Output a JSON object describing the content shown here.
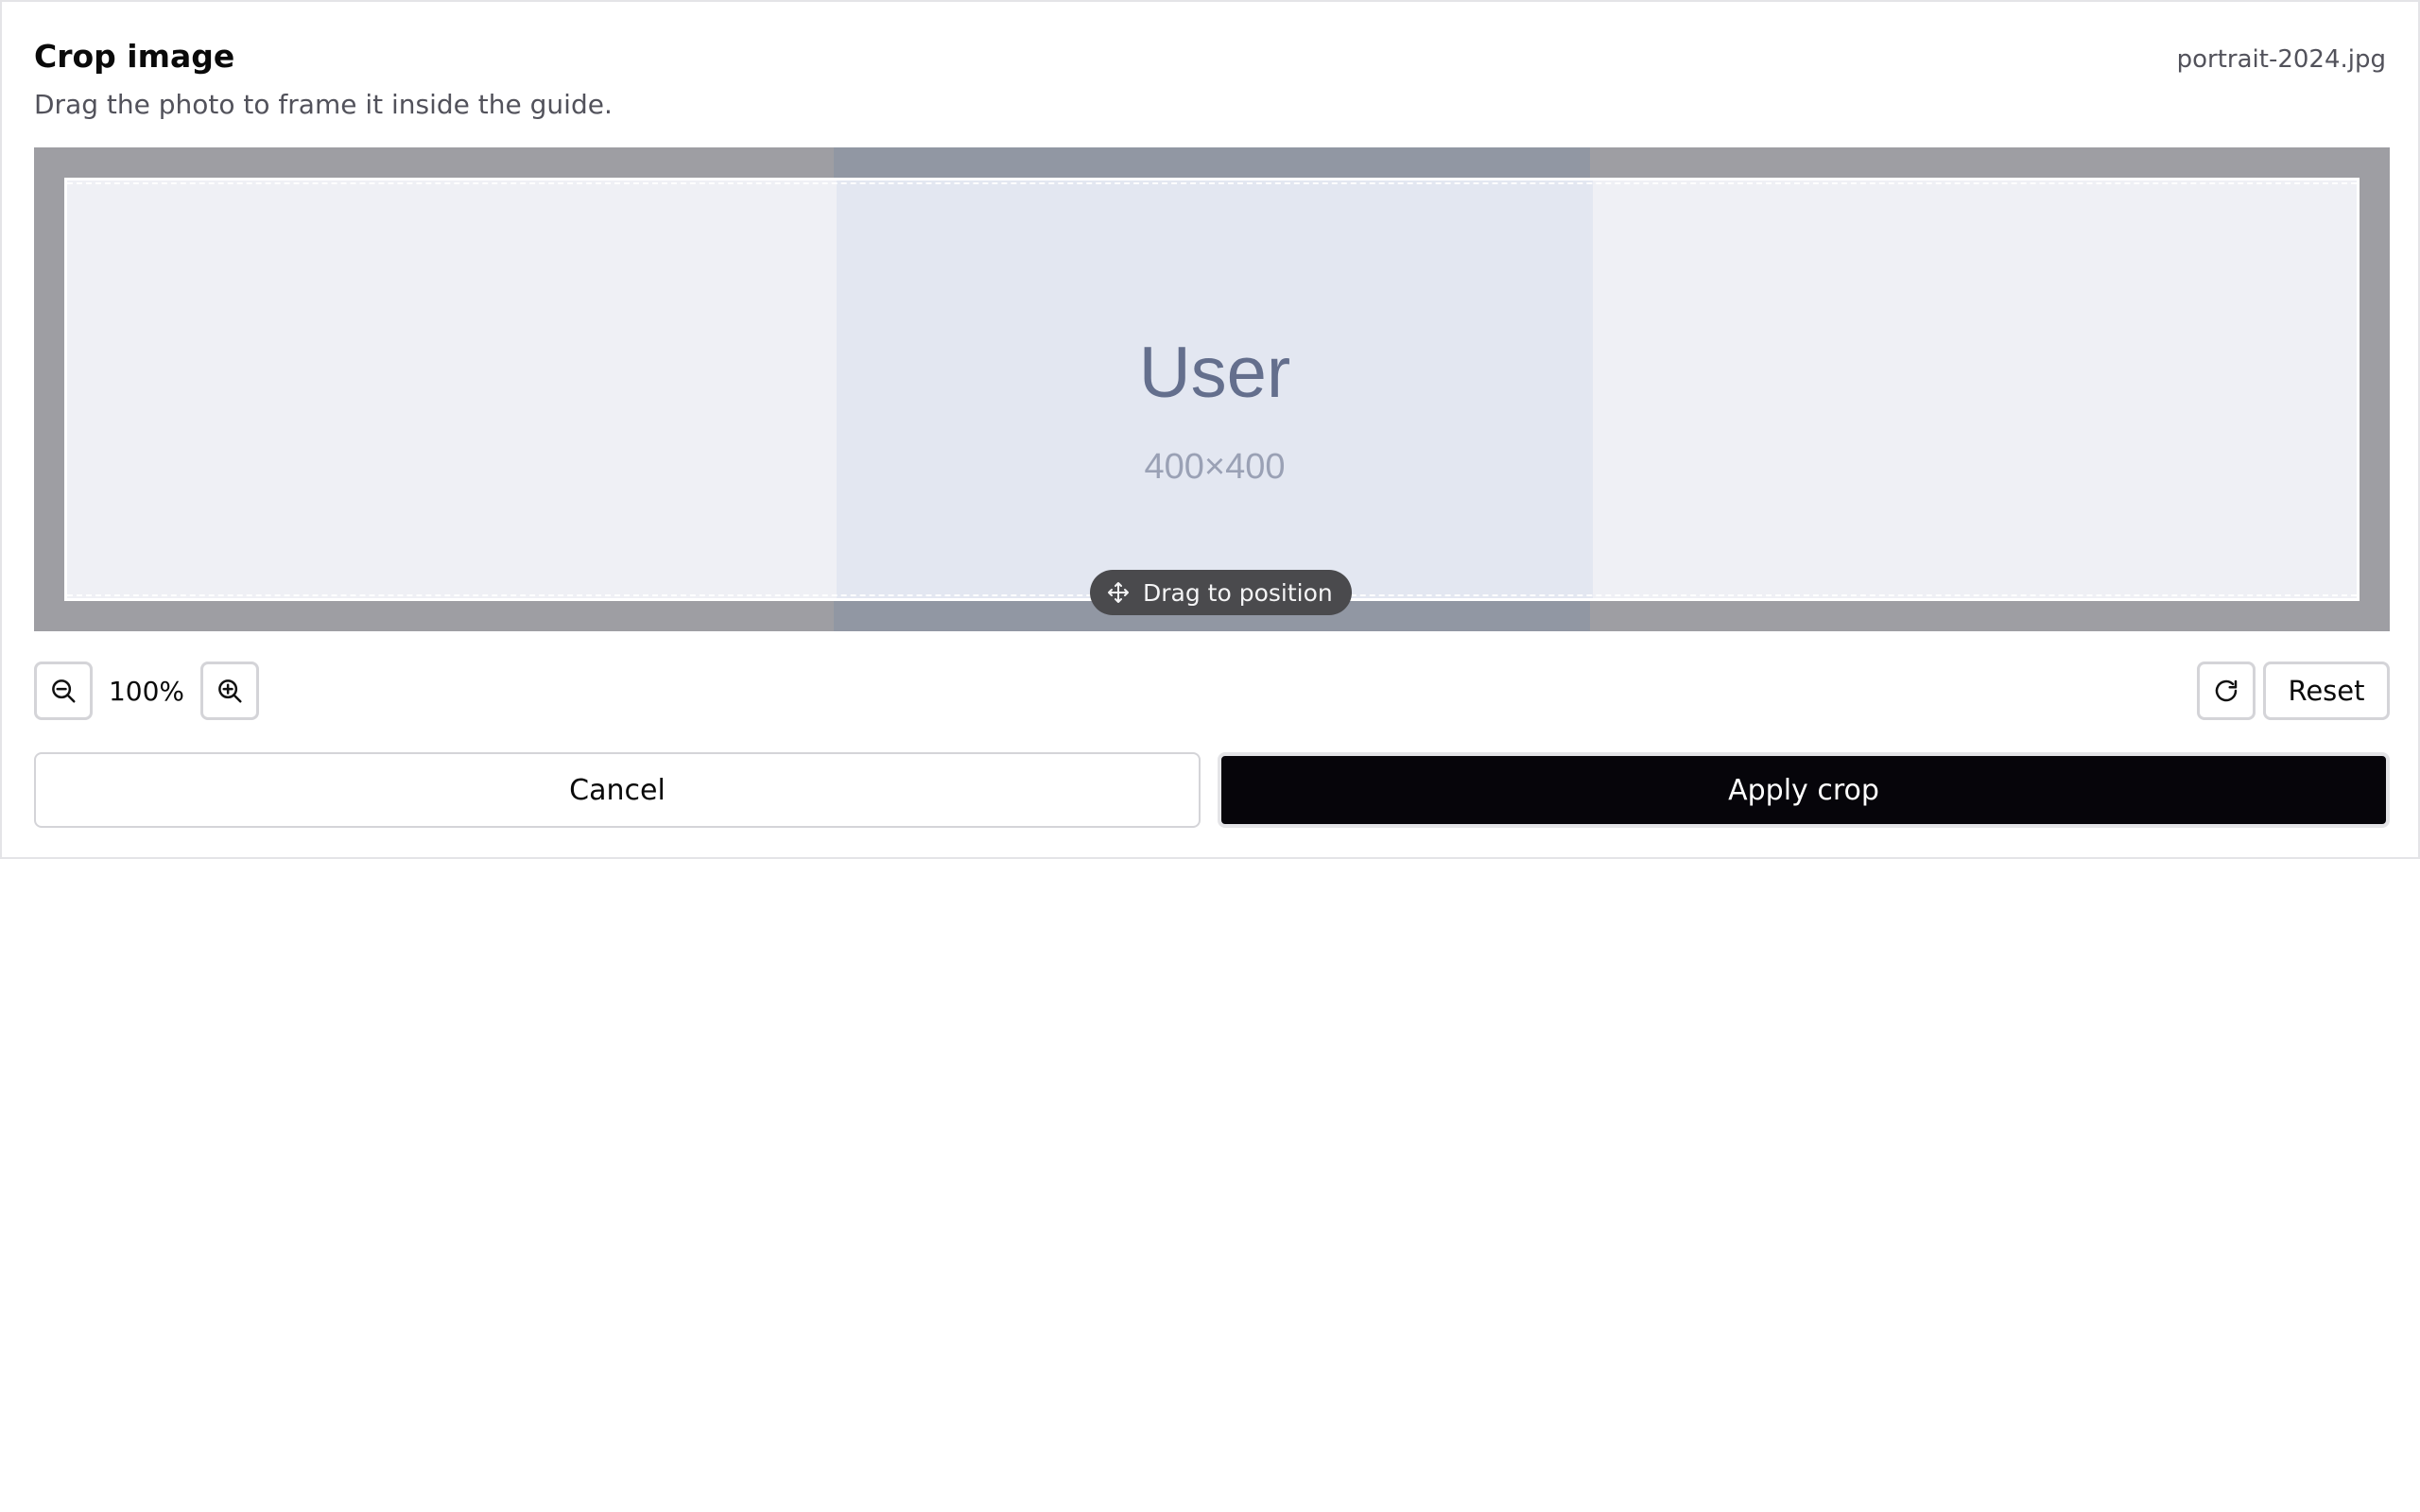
{
  "dialog": {
    "title": "Crop image",
    "subtitle": "Drag the photo to frame it inside the guide.",
    "filename": "portrait-2024.jpg"
  },
  "preview": {
    "placeholder_label": "User",
    "placeholder_size": "400×400",
    "drag_hint": "Drag to position"
  },
  "controls": {
    "zoom_level": "100%",
    "reset_label": "Reset"
  },
  "actions": {
    "cancel_label": "Cancel",
    "apply_label": "Apply crop"
  },
  "colors": {
    "primary": "#06050a",
    "stage_bg": "#9e9ea3",
    "guide_border": "#ffffff"
  },
  "icons": {
    "zoom_out": "zoom-out-icon",
    "zoom_in": "zoom-in-icon",
    "rotate": "rotate-icon",
    "move": "move-icon"
  }
}
